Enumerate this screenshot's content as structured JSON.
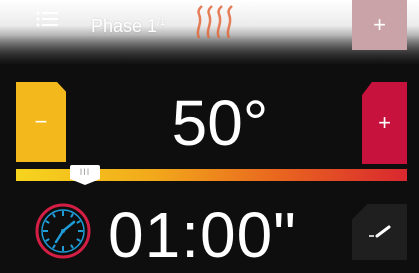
{
  "header": {
    "phase_label": "Phase 1",
    "phase_superscript": "/1",
    "menu_icon": "hamburger-menu-icon",
    "heat_icon": "heat-waves-icon",
    "add_label": "+"
  },
  "temperature": {
    "decrease_label": "−",
    "value": "50°",
    "increase_label": "+",
    "slider_handle_text": "III"
  },
  "time": {
    "value": "01:00\"",
    "clock_icon": "clock-icon",
    "edit_icon": "edit-pencil-icon"
  },
  "colors": {
    "minus": "#f3b81b",
    "plus": "#c6123c",
    "clock_outer": "#d51e44",
    "clock_hands": "#1f9bd6"
  }
}
